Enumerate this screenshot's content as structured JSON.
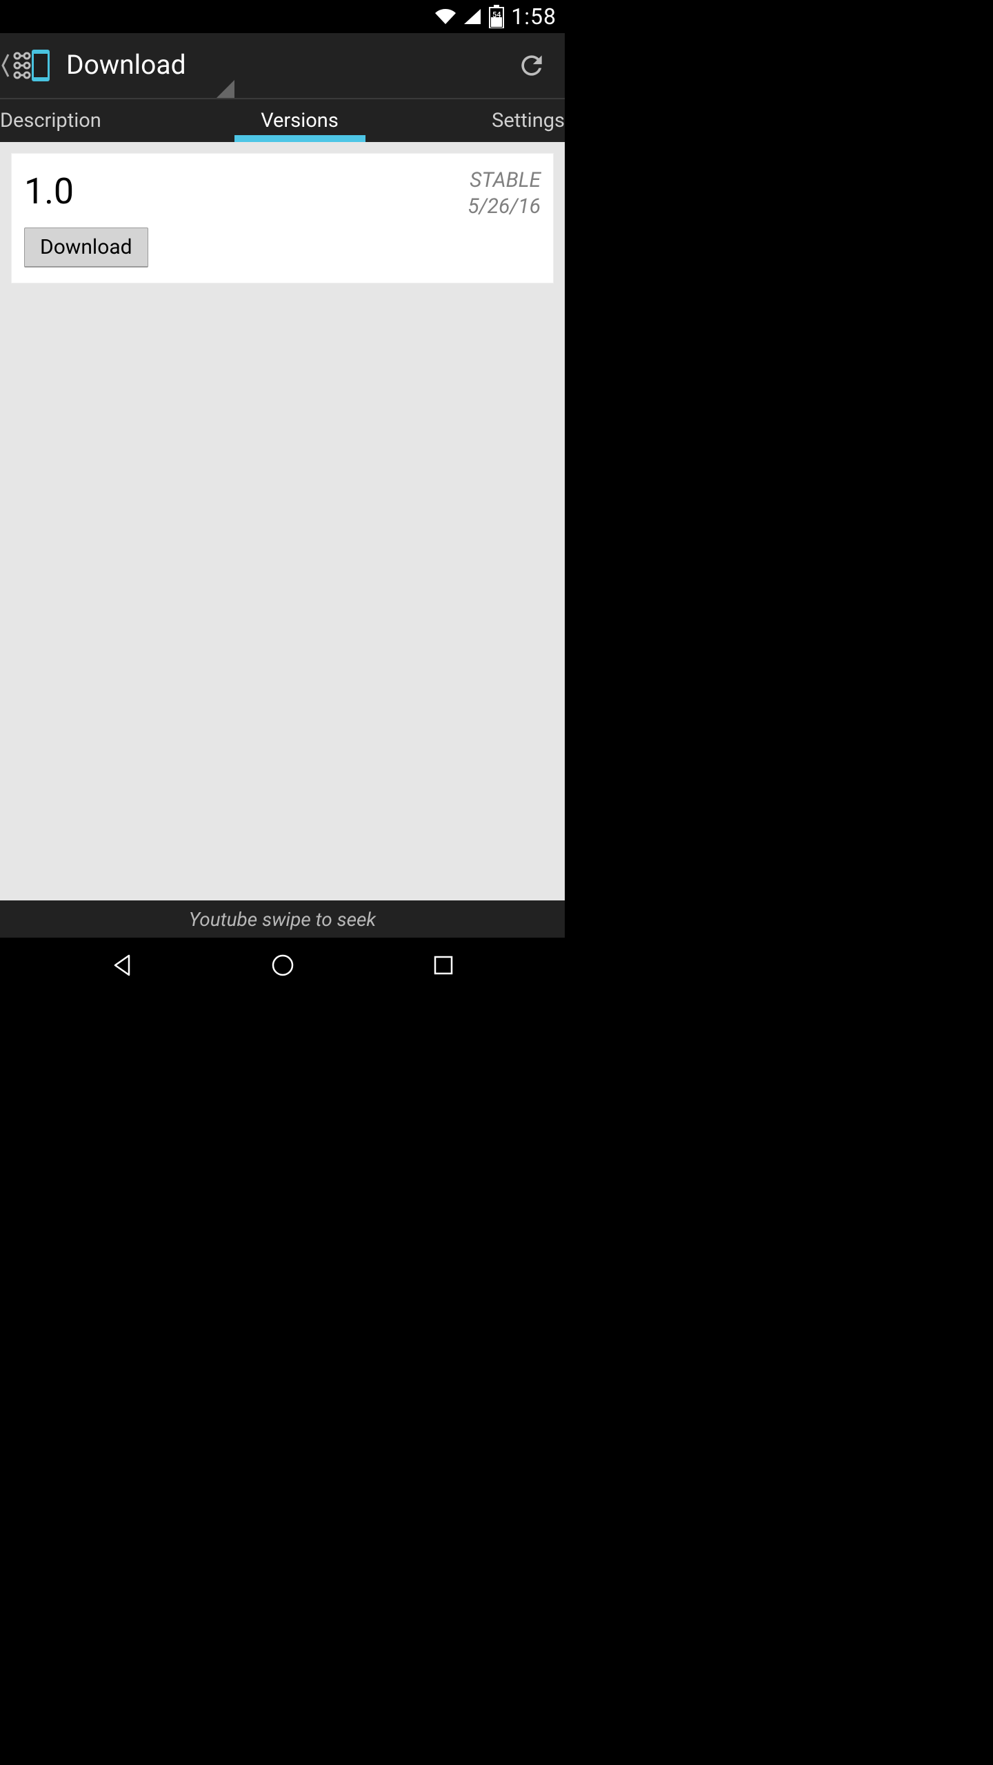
{
  "status": {
    "time": "1:58",
    "battery_label": "54"
  },
  "actionbar": {
    "title": "Download"
  },
  "tabs": {
    "description": "Description",
    "versions": "Versions",
    "settings": "Settings"
  },
  "card": {
    "version": "1.0",
    "stability": "STABLE",
    "date": "5/26/16",
    "button": "Download"
  },
  "footer": {
    "text": "Youtube swipe to seek"
  },
  "colors": {
    "accent": "#4ec6e6"
  }
}
